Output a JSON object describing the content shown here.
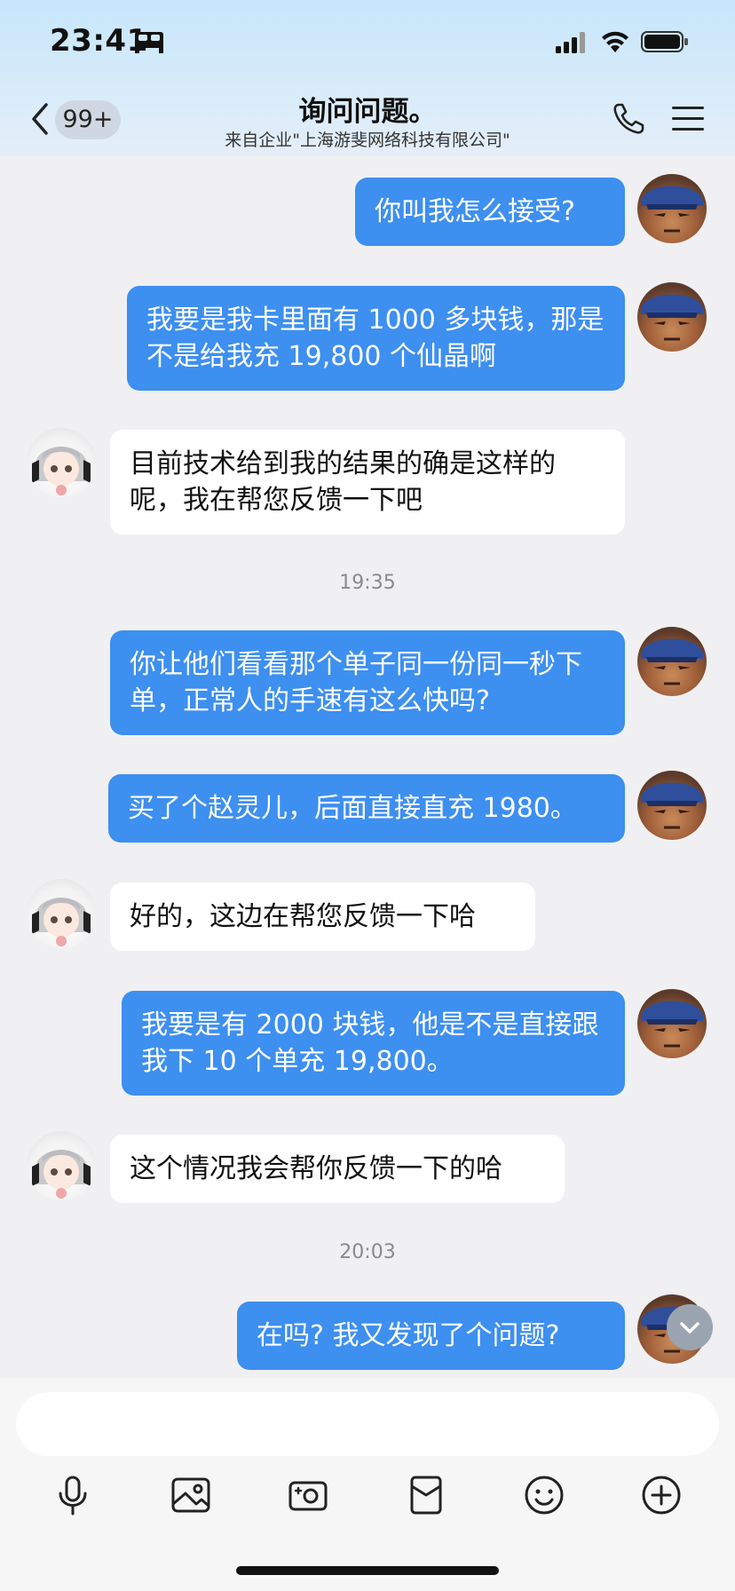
{
  "status_bar": {
    "time": "23:41"
  },
  "header": {
    "back_badge": "99+",
    "title": "询问问题。",
    "subtitle": "来自企业\"上海游斐网络科技有限公司\""
  },
  "messages": [
    {
      "from": "me",
      "text": "你叫我怎么接受?"
    },
    {
      "from": "me",
      "text": "我要是我卡里面有 1000 多块钱，那是不是给我充 19,800 个仙晶啊"
    },
    {
      "from": "agent",
      "text": "目前技术给到我的结果的确是这样的呢，我在帮您反馈一下吧"
    },
    {
      "type": "time",
      "text": "19:35"
    },
    {
      "from": "me",
      "text": "你让他们看看那个单子同一份同一秒下单，正常人的手速有这么快吗?"
    },
    {
      "from": "me",
      "text": "买了个赵灵儿，后面直接直充 1980。"
    },
    {
      "from": "agent",
      "text": "好的，这边在帮您反馈一下哈"
    },
    {
      "from": "me",
      "text": "我要是有 2000 块钱，他是不是直接跟我下 10 个单充 19,800。"
    },
    {
      "from": "agent",
      "text": "这个情况我会帮你反馈一下的哈"
    },
    {
      "type": "time",
      "text": "20:03"
    },
    {
      "from": "me",
      "text": "在吗? 我又发现了个问题?"
    }
  ],
  "composer": {
    "input_value": "",
    "tools": [
      "microphone-icon",
      "image-icon",
      "camera-icon",
      "red-packet-icon",
      "emoji-icon",
      "plus-icon"
    ]
  },
  "colors": {
    "bubble_me": "#3d8ff0",
    "bubble_agent": "#ffffff",
    "header_bg": "#c7e6fb"
  }
}
